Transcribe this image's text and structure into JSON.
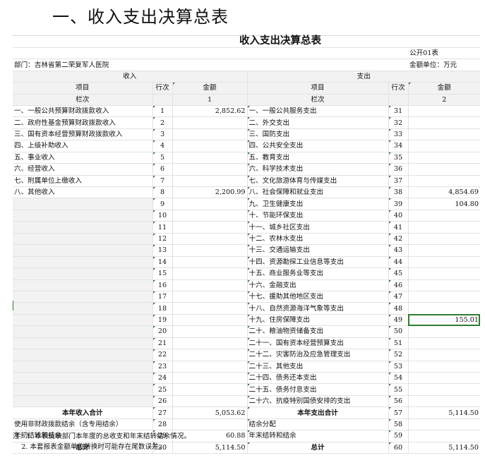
{
  "page_heading": "一、收入支出决算总表",
  "report": {
    "title": "收入支出决算总表",
    "form_no": "公开01表",
    "department": "部门：吉林省第二荣复军人医院",
    "unit": "金额单位：万元",
    "income_header": "收入",
    "expense_header": "支出",
    "col_item": "项目",
    "col_row": "行次",
    "col_amount": "金额",
    "col_label": "栏次",
    "col_1": "1",
    "col_2": "2"
  },
  "rows": [
    {
      "in_item": "一、一般公共预算财政拨款收入",
      "in_no": "1",
      "in_amt": "2,852.62",
      "ex_item": "一、一般公共服务支出",
      "ex_no": "31",
      "ex_amt": ""
    },
    {
      "in_item": "二、政府性基金预算财政拨款收入",
      "in_no": "2",
      "in_amt": "",
      "ex_item": "二、外交支出",
      "ex_no": "32",
      "ex_amt": ""
    },
    {
      "in_item": "三、国有资本经营预算财政拨款收入",
      "in_no": "3",
      "in_amt": "",
      "ex_item": "三、国防支出",
      "ex_no": "33",
      "ex_amt": ""
    },
    {
      "in_item": "四、上级补助收入",
      "in_no": "4",
      "in_amt": "",
      "ex_item": "四、公共安全支出",
      "ex_no": "34",
      "ex_amt": ""
    },
    {
      "in_item": "五、事业收入",
      "in_no": "5",
      "in_amt": "",
      "ex_item": "五、教育支出",
      "ex_no": "35",
      "ex_amt": ""
    },
    {
      "in_item": "六、经营收入",
      "in_no": "6",
      "in_amt": "",
      "ex_item": "六、科学技术支出",
      "ex_no": "36",
      "ex_amt": ""
    },
    {
      "in_item": "七、附属单位上缴收入",
      "in_no": "7",
      "in_amt": "",
      "ex_item": "七、文化旅游体育与传媒支出",
      "ex_no": "37",
      "ex_amt": ""
    },
    {
      "in_item": "八、其他收入",
      "in_no": "8",
      "in_amt": "2,200.99",
      "ex_item": "八、社会保障和就业支出",
      "ex_no": "38",
      "ex_amt": "4,854.69"
    },
    {
      "in_item": "",
      "in_no": "9",
      "in_amt": "",
      "ex_item": "九、卫生健康支出",
      "ex_no": "39",
      "ex_amt": "104.80"
    },
    {
      "in_item": "",
      "in_no": "10",
      "in_amt": "",
      "ex_item": "十、节能环保支出",
      "ex_no": "40",
      "ex_amt": ""
    },
    {
      "in_item": "",
      "in_no": "11",
      "in_amt": "",
      "ex_item": "十一、城乡社区支出",
      "ex_no": "41",
      "ex_amt": ""
    },
    {
      "in_item": "",
      "in_no": "12",
      "in_amt": "",
      "ex_item": "十二、农林水支出",
      "ex_no": "42",
      "ex_amt": ""
    },
    {
      "in_item": "",
      "in_no": "13",
      "in_amt": "",
      "ex_item": "十三、交通运输支出",
      "ex_no": "43",
      "ex_amt": ""
    },
    {
      "in_item": "",
      "in_no": "14",
      "in_amt": "",
      "ex_item": "十四、资源勘探工业信息等支出",
      "ex_no": "44",
      "ex_amt": ""
    },
    {
      "in_item": "",
      "in_no": "15",
      "in_amt": "",
      "ex_item": "十五、商业服务业等支出",
      "ex_no": "45",
      "ex_amt": ""
    },
    {
      "in_item": "",
      "in_no": "16",
      "in_amt": "",
      "ex_item": "十六、金融支出",
      "ex_no": "46",
      "ex_amt": ""
    },
    {
      "in_item": "",
      "in_no": "17",
      "in_amt": "",
      "ex_item": "十七、援助其他地区支出",
      "ex_no": "47",
      "ex_amt": ""
    },
    {
      "in_item": "",
      "in_no": "18",
      "in_amt": "",
      "ex_item": "十八、自然资源海洋气象等支出",
      "ex_no": "48",
      "ex_amt": ""
    },
    {
      "in_item": "",
      "in_no": "19",
      "in_amt": "",
      "ex_item": "十九、住房保障支出",
      "ex_no": "49",
      "ex_amt": "155.01"
    },
    {
      "in_item": "",
      "in_no": "20",
      "in_amt": "",
      "ex_item": "二十、粮油物资储备支出",
      "ex_no": "50",
      "ex_amt": ""
    },
    {
      "in_item": "",
      "in_no": "21",
      "in_amt": "",
      "ex_item": "二十一、国有资本经营预算支出",
      "ex_no": "51",
      "ex_amt": ""
    },
    {
      "in_item": "",
      "in_no": "22",
      "in_amt": "",
      "ex_item": "二十二、灾害防治及应急管理支出",
      "ex_no": "52",
      "ex_amt": ""
    },
    {
      "in_item": "",
      "in_no": "23",
      "in_amt": "",
      "ex_item": "二十三、其他支出",
      "ex_no": "53",
      "ex_amt": ""
    },
    {
      "in_item": "",
      "in_no": "24",
      "in_amt": "",
      "ex_item": "二十四、债务还本支出",
      "ex_no": "54",
      "ex_amt": ""
    },
    {
      "in_item": "",
      "in_no": "25",
      "in_amt": "",
      "ex_item": "二十五、债务付息支出",
      "ex_no": "55",
      "ex_amt": ""
    },
    {
      "in_item": "",
      "in_no": "26",
      "in_amt": "",
      "ex_item": "二十六、抗疫特别国债安排的支出",
      "ex_no": "56",
      "ex_amt": ""
    }
  ],
  "totals": [
    {
      "in_item": "本年收入合计",
      "in_no": "27",
      "in_amt": "5,053.62",
      "ex_item": "本年支出合计",
      "ex_no": "57",
      "ex_amt": "5,114.50"
    },
    {
      "in_item": "使用非财政拨款结余（含专用结余）",
      "in_no": "28",
      "in_amt": "",
      "ex_item": "结余分配",
      "ex_no": "58",
      "ex_amt": ""
    },
    {
      "in_item": "年初结转和结余",
      "in_no": "29",
      "in_amt": "60.88",
      "ex_item": "年末结转和结余",
      "ex_no": "59",
      "ex_amt": ""
    },
    {
      "in_item": "总计",
      "in_no": "30",
      "in_amt": "5,114.50",
      "ex_item": "总计",
      "ex_no": "60",
      "ex_amt": "5,114.50"
    }
  ],
  "notes": [
    "注：1. 本表反映部门本年度的总收支和年末结转结余情况。",
    "    2. 本套报表金额单位转换时可能存在尾数误差。"
  ]
}
